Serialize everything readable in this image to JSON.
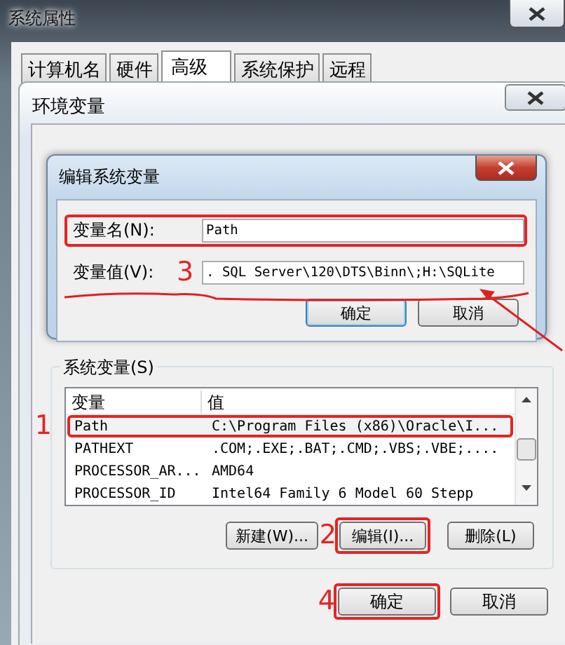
{
  "outer_window": {
    "title": "系统属性",
    "tabs": [
      {
        "label": "计算机名",
        "selected": false
      },
      {
        "label": "硬件",
        "selected": false
      },
      {
        "label": "高级",
        "selected": true
      },
      {
        "label": "系统保护",
        "selected": false
      },
      {
        "label": "远程",
        "selected": false
      }
    ]
  },
  "env_window": {
    "title": "环境变量",
    "system_variables": {
      "title": "系统变量(S)",
      "columns": [
        "变量",
        "值"
      ],
      "rows": [
        {
          "name": "Path",
          "value": "C:\\Program Files (x86)\\Oracle\\I...",
          "selected": true,
          "highlighted": true,
          "marker": "1"
        },
        {
          "name": "PATHEXT",
          "value": ".COM;.EXE;.BAT;.CMD;.VBS;.VBE;....",
          "selected": false,
          "highlighted": false
        },
        {
          "name": "PROCESSOR_AR...",
          "value": "AMD64",
          "selected": false,
          "highlighted": false
        },
        {
          "name": "PROCESSOR_ID",
          "value": "Intel64 Family 6 Model 60 Stepp",
          "selected": false,
          "highlighted": false
        }
      ],
      "buttons": [
        {
          "label": "新建(W)...",
          "highlighted": false
        },
        {
          "label": "编辑(I)...",
          "highlighted": true,
          "marker": "2"
        },
        {
          "label": "删除(L)",
          "highlighted": false
        }
      ]
    },
    "buttons": [
      {
        "label": "确定",
        "highlighted": true,
        "marker": "4"
      },
      {
        "label": "取消",
        "highlighted": false
      }
    ]
  },
  "edit_dialog": {
    "title": "编辑系统变量",
    "fields": [
      {
        "label": "变量名(N):",
        "value": "Path",
        "highlighted": true,
        "underlined": false
      },
      {
        "label": "变量值(V):",
        "value": ". SQL Server\\120\\DTS\\Binn\\;H:\\SQLite",
        "highlighted": false,
        "underlined": true,
        "marker": "3"
      }
    ],
    "buttons": [
      {
        "label": "确定",
        "default": true
      },
      {
        "label": "取消",
        "default": false
      }
    ]
  }
}
